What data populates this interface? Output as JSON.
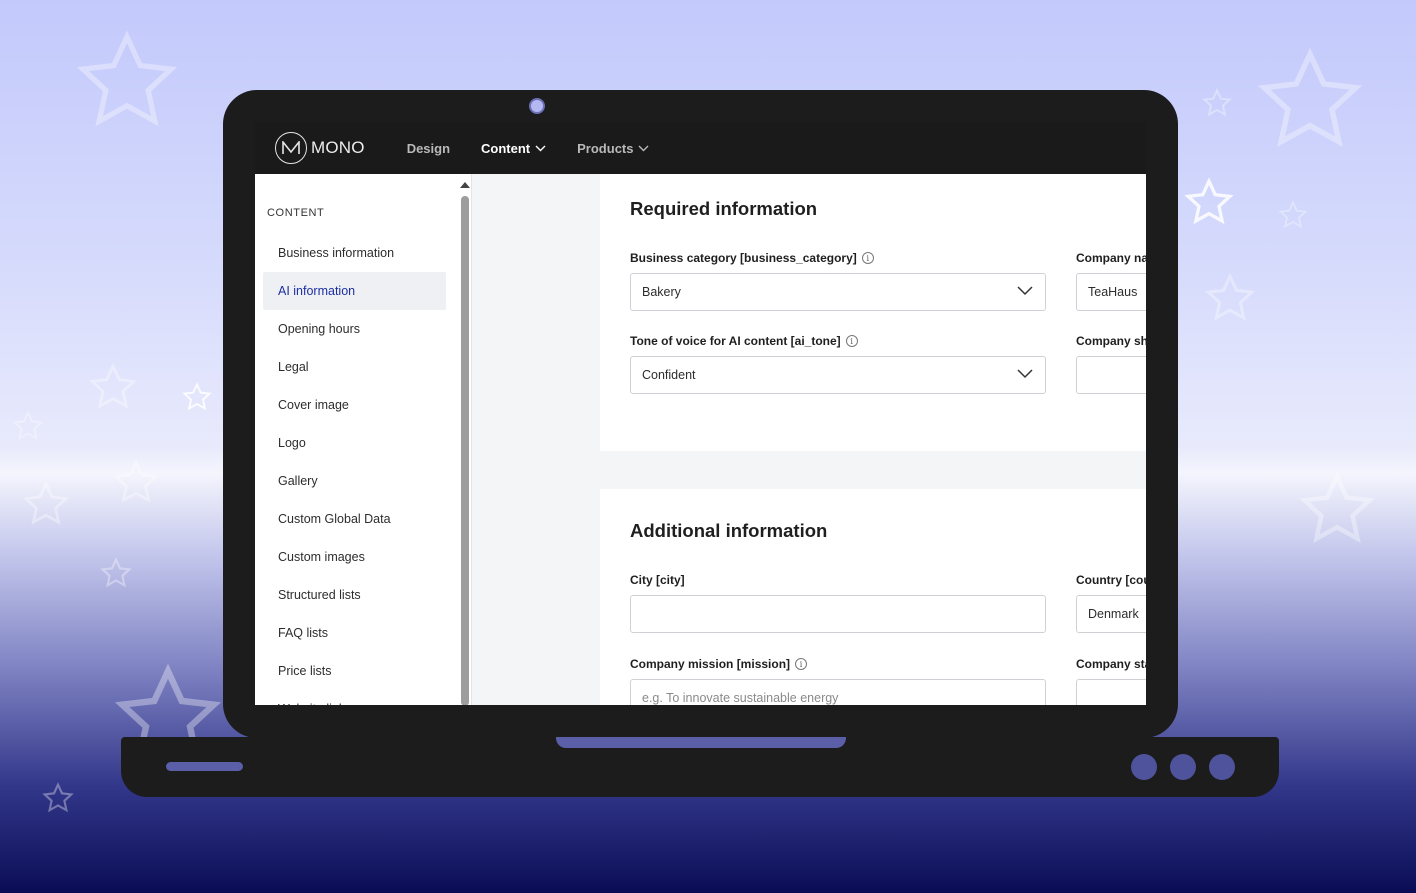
{
  "app": {
    "brand": "MONO",
    "nav": [
      {
        "label": "Design",
        "has_dropdown": false,
        "active": false
      },
      {
        "label": "Content",
        "has_dropdown": true,
        "active": true
      },
      {
        "label": "Products",
        "has_dropdown": true,
        "active": false
      }
    ]
  },
  "sidebar": {
    "heading": "CONTENT",
    "items": [
      {
        "label": "Business information"
      },
      {
        "label": "AI information",
        "active": true
      },
      {
        "label": "Opening hours"
      },
      {
        "label": "Legal"
      },
      {
        "label": "Cover image"
      },
      {
        "label": "Logo"
      },
      {
        "label": "Gallery"
      },
      {
        "label": "Custom Global Data"
      },
      {
        "label": "Custom images"
      },
      {
        "label": "Structured lists"
      },
      {
        "label": "FAQ lists"
      },
      {
        "label": "Price lists"
      },
      {
        "label": "Website links"
      }
    ]
  },
  "required": {
    "title": "Required information",
    "business_category": {
      "label": "Business category [business_category]",
      "value": "Bakery"
    },
    "company_name": {
      "label": "Company name",
      "value": "TeaHaus"
    },
    "ai_tone": {
      "label": "Tone of voice for AI content [ai_tone]",
      "value": "Confident"
    },
    "company_short": {
      "label": "Company short description",
      "value": ""
    }
  },
  "additional": {
    "title": "Additional information",
    "city": {
      "label": "City [city]",
      "value": ""
    },
    "country": {
      "label": "Country [country]",
      "value": "Denmark"
    },
    "mission": {
      "label": "Company mission [mission]",
      "placeholder": "e.g. To innovate sustainable energy"
    },
    "company_statement": {
      "label": "Company statement",
      "value": ""
    }
  },
  "colors": {
    "accent": "#1d2fa0",
    "topbar": "#1a1a1a",
    "laptop": "#1c1c1c"
  }
}
